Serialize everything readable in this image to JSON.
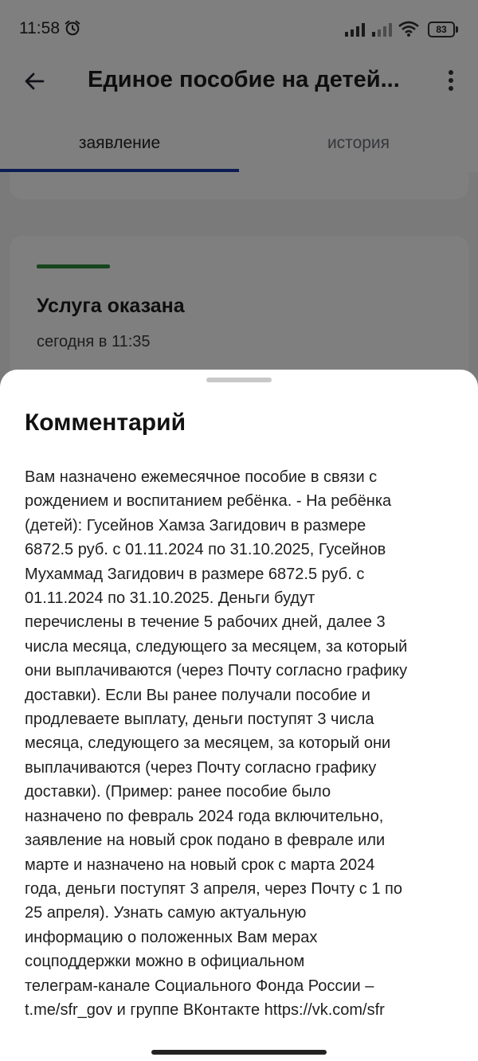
{
  "status_bar": {
    "time": "11:58",
    "battery": "83",
    "icons": [
      "alarm-icon",
      "signal-icon",
      "signal-icon",
      "wifi-icon",
      "battery-icon"
    ]
  },
  "app_bar": {
    "title": "Единое пособие на детей...",
    "back_icon": "arrow-back-icon",
    "menu_icon": "more-vertical-icon"
  },
  "tabs": [
    {
      "label": "заявление",
      "active": true
    },
    {
      "label": "история",
      "active": false
    }
  ],
  "status_card": {
    "accent_color": "#2e8b3b",
    "title": "Услуга оказана",
    "date": "сегодня в 11:35"
  },
  "comment_sheet": {
    "title": "Комментарий",
    "lines": [
      "Вам назначено ежемесячное пособие в связи с",
      "рождением и воспитанием ребёнка. - На ребёнка",
      "(детей): Гусейнов Хамза Загидович в размере",
      "6872.5 руб. с 01.11.2024 по 31.10.2025, Гусейнов",
      "Мухаммад Загидович в размере 6872.5 руб. с",
      "01.11.2024 по 31.10.2025. Деньги будут",
      "перечислены в течение 5 рабочих дней, далее 3",
      "числа месяца, следующего за месяцем, за который",
      "они выплачиваются (через Почту согласно графику",
      "доставки). Если Вы ранее получали пособие и",
      "продлеваете выплату, деньги поступят 3 числа",
      "месяца, следующего за месяцем, за который они",
      "выплачиваются (через Почту согласно графику",
      "доставки). (Пример: ранее пособие было",
      "назначено по февраль 2024 года включительно,",
      "заявление на новый срок подано в феврале или",
      "марте и назначено на новый срок с марта 2024",
      "года, деньги поступят 3 апреля, через Почту с 1 по",
      "25 апреля). Узнать самую актуальную",
      "информацию о положенных Вам мерах",
      "соцподдержки можно в официальном",
      "телеграм-канале Социального Фонда России –",
      "t.me/sfr_gov и группе ВКонтакте https://vk.com/sfr"
    ]
  },
  "colors": {
    "tab_indicator": "#1a3aa6",
    "scrim": "rgba(0,0,0,0.5)"
  }
}
